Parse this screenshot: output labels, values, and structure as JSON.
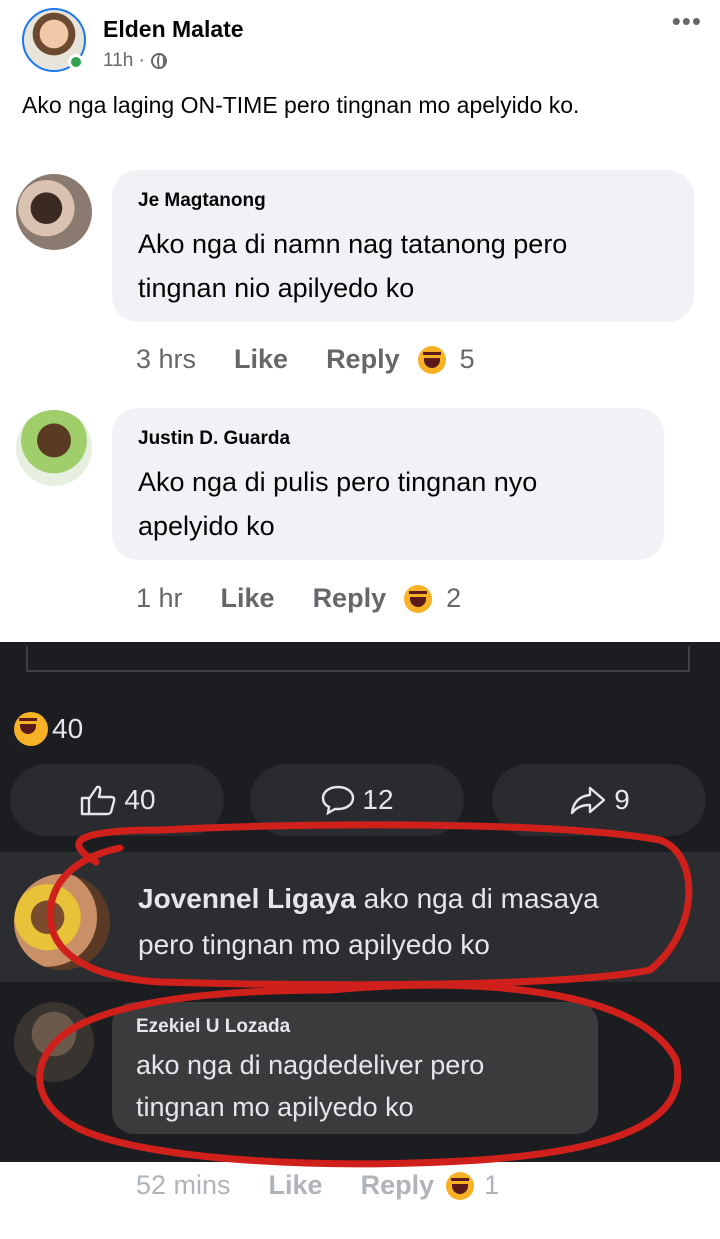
{
  "post": {
    "author": "Elden Malate",
    "time": "11h ·",
    "caption": "Ako nga laging ON-TIME pero tingnan mo apelyido ko.",
    "more_label": "•••"
  },
  "image": {
    "comments_light": [
      {
        "name": "Je Magtanong",
        "text_line1": "Ako nga di namn nag tatanong pero",
        "text_line2": "tingnan nio apilyedo ko",
        "time": "3 hrs",
        "like": "Like",
        "reply": "Reply",
        "reaction_count": "5"
      },
      {
        "name": "Justin D. Guarda",
        "text_line1": "Ako nga di  pulis pero tingnan nyo",
        "text_line2": "apelyido ko",
        "time": "1 hr",
        "like": "Like",
        "reply": "Reply",
        "reaction_count": "2"
      }
    ],
    "reactions_total": "40",
    "buttons": {
      "like_count": "40",
      "comment_count": "12",
      "share_count": "9"
    },
    "highlight_comment": {
      "name": "Jovennel Ligaya",
      "text_inline": " ako nga di masaya",
      "text_line2": "pero tingnan mo apilyedo ko"
    },
    "last_comment": {
      "name": "Ezekiel U Lozada",
      "text_line1": "ako nga di nagdedeliver pero",
      "text_line2": "tingnan mo apilyedo ko",
      "time": "52 mins",
      "like": "Like",
      "reply": "Reply",
      "reaction_count": "1"
    }
  },
  "colors": {
    "accent": "#1877f2",
    "online": "#31a24c",
    "annotation_red": "#d0201c",
    "dark_bg": "#1c1d20"
  }
}
